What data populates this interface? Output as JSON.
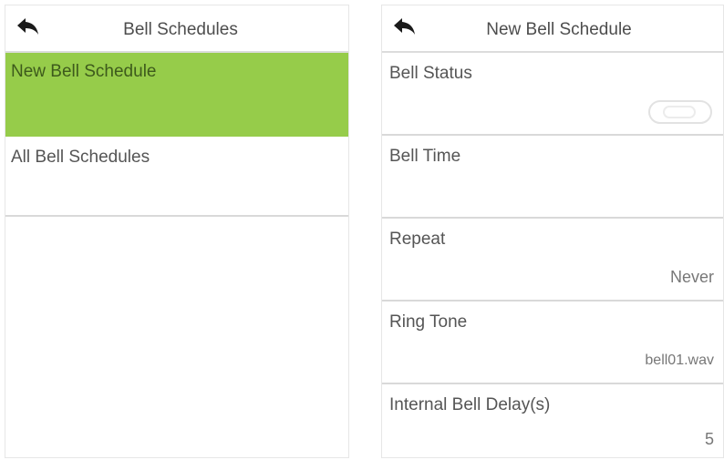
{
  "left_panel": {
    "title": "Bell Schedules",
    "back_icon": "back-arrow-icon",
    "items": [
      {
        "label": "New Bell Schedule",
        "selected": true
      },
      {
        "label": "All Bell Schedules",
        "selected": false
      }
    ]
  },
  "right_panel": {
    "title": "New Bell Schedule",
    "back_icon": "back-arrow-icon",
    "settings": [
      {
        "label": "Bell Status",
        "value": "",
        "control": "toggle-off"
      },
      {
        "label": "Bell Time",
        "value": ""
      },
      {
        "label": "Repeat",
        "value": "Never"
      },
      {
        "label": "Ring Tone",
        "value": "bell01.wav"
      },
      {
        "label": "Internal Bell Delay(s)",
        "value": "5"
      }
    ]
  },
  "colors": {
    "selected_background": "#96cc4a",
    "divider": "#d9d9d9",
    "text": "#555555"
  }
}
